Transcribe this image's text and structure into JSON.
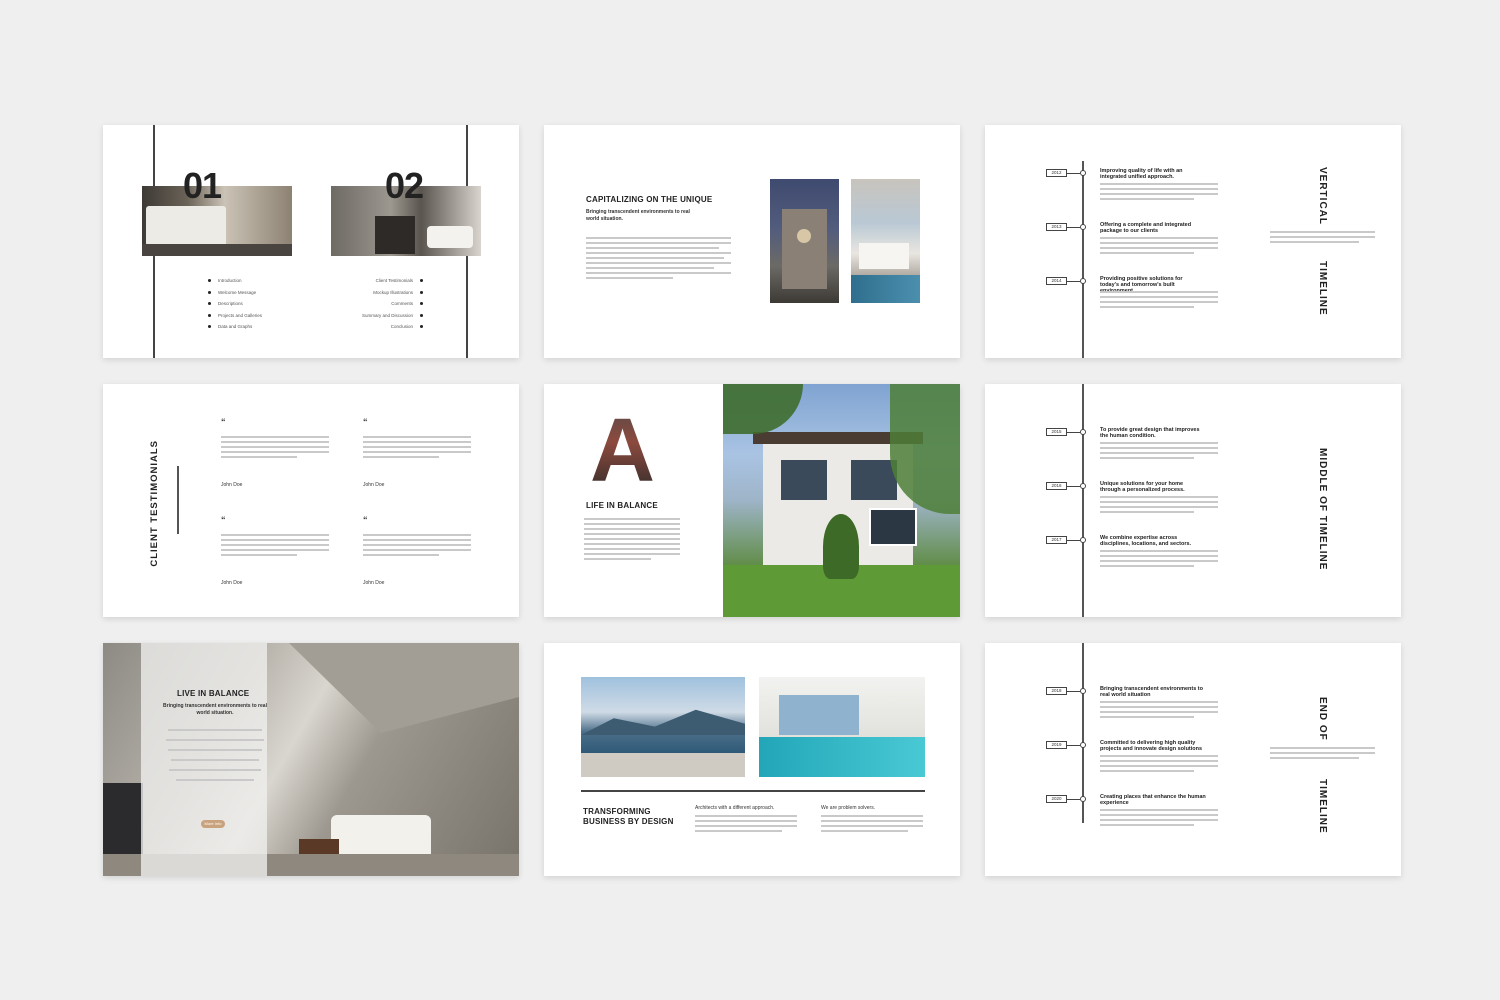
{
  "slide1": {
    "num1": "01",
    "num2": "02",
    "left_items": [
      "Introduction",
      "Welcome Message",
      "Descriptions",
      "Projects and Galleries",
      "Data and Graphs"
    ],
    "right_items": [
      "Client Testimonials",
      "Mockup Illustrations",
      "Comments",
      "Summary and Discussion",
      "Conclusion"
    ]
  },
  "slide2": {
    "title": "CAPITALIZING ON THE UNIQUE",
    "subtitle": "Bringing transcendent environments to real world situation."
  },
  "slide3": {
    "title_a": "VERTICAL",
    "title_b": "TIMELINE",
    "events": [
      {
        "year": "2012",
        "title": "Improving quality of life with an integrated unified approach."
      },
      {
        "year": "2013",
        "title": "Offering a complete and integrated package to our clients"
      },
      {
        "year": "2014",
        "title": "Providing positive solutions for today's and tomorrow's built environment"
      }
    ]
  },
  "slide4": {
    "title": "CLIENT TESTIMONIALS",
    "authors": [
      "John Doe",
      "John Doe",
      "John Doe",
      "John Doe"
    ]
  },
  "slide5": {
    "letter": "A",
    "title": "LIFE IN BALANCE"
  },
  "slide6": {
    "title": "MIDDLE OF TIMELINE",
    "events": [
      {
        "year": "2015",
        "title": "To provide great design that improves the human condition."
      },
      {
        "year": "2016",
        "title": "Unique solutions for your home through a personalized process."
      },
      {
        "year": "2017",
        "title": "We combine expertise across disciplines, locations, and sectors."
      }
    ]
  },
  "slide7": {
    "title": "LIVE IN BALANCE",
    "subtitle": "Bringing transcendent environments to real world situation.",
    "button": "More Info"
  },
  "slide8": {
    "title": "TRANSFORMING BUSINESS BY DESIGN",
    "col1_head": "Architects with a different approach.",
    "col2_head": "We are problem solvers."
  },
  "slide9": {
    "title_a": "END OF",
    "title_b": "TIMELINE",
    "events": [
      {
        "year": "2018",
        "title": "Bringing transcendent environments to real world situation"
      },
      {
        "year": "2019",
        "title": "Committed to delivering high quality projects and innovate design solutions"
      },
      {
        "year": "2020",
        "title": "Creating places that enhance the human experience"
      }
    ]
  },
  "colors": {
    "background": "#efefef",
    "accent": "#c9a27e",
    "text": "#222222"
  }
}
